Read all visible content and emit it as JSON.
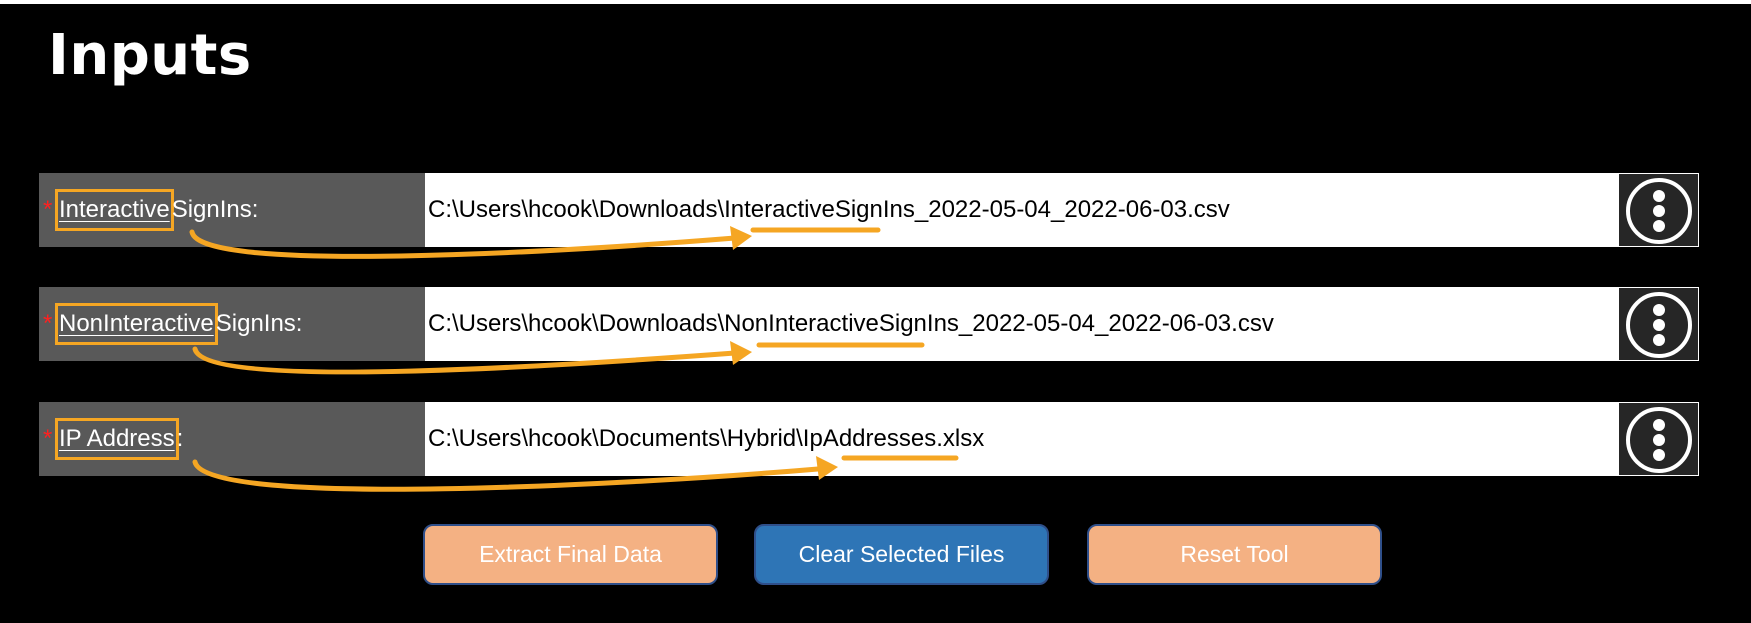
{
  "page": {
    "title": "Inputs"
  },
  "rows": [
    {
      "required_mark": "*",
      "label_key": "Interactive",
      "label_rest": "SignIns:",
      "path": "C:\\Users\\hcook\\Downloads\\InteractiveSignIns_2022-05-04_2022-06-03.csv",
      "button_icon": "more-vertical-icon"
    },
    {
      "required_mark": "*",
      "label_key": "NonInteractive",
      "label_rest": "SignIns:",
      "path": "C:\\Users\\hcook\\Downloads\\NonInteractiveSignIns_2022-05-04_2022-06-03.csv",
      "button_icon": "more-vertical-icon"
    },
    {
      "required_mark": "*",
      "label_key": "IP Address",
      "label_rest": ":",
      "path": "C:\\Users\\hcook\\Documents\\Hybrid\\IpAddresses.xlsx",
      "button_icon": "more-vertical-icon"
    }
  ],
  "actions": {
    "extract_label": "Extract Final Data",
    "clear_label": "Clear Selected Files",
    "reset_label": "Reset Tool"
  },
  "colors": {
    "panel_background": "#000000",
    "label_background": "#595959",
    "required_mark": "#ff2020",
    "highlight": "#f5a623",
    "extract_button": "#f4b183",
    "clear_button": "#2e75b6",
    "reset_button": "#f4b183"
  }
}
